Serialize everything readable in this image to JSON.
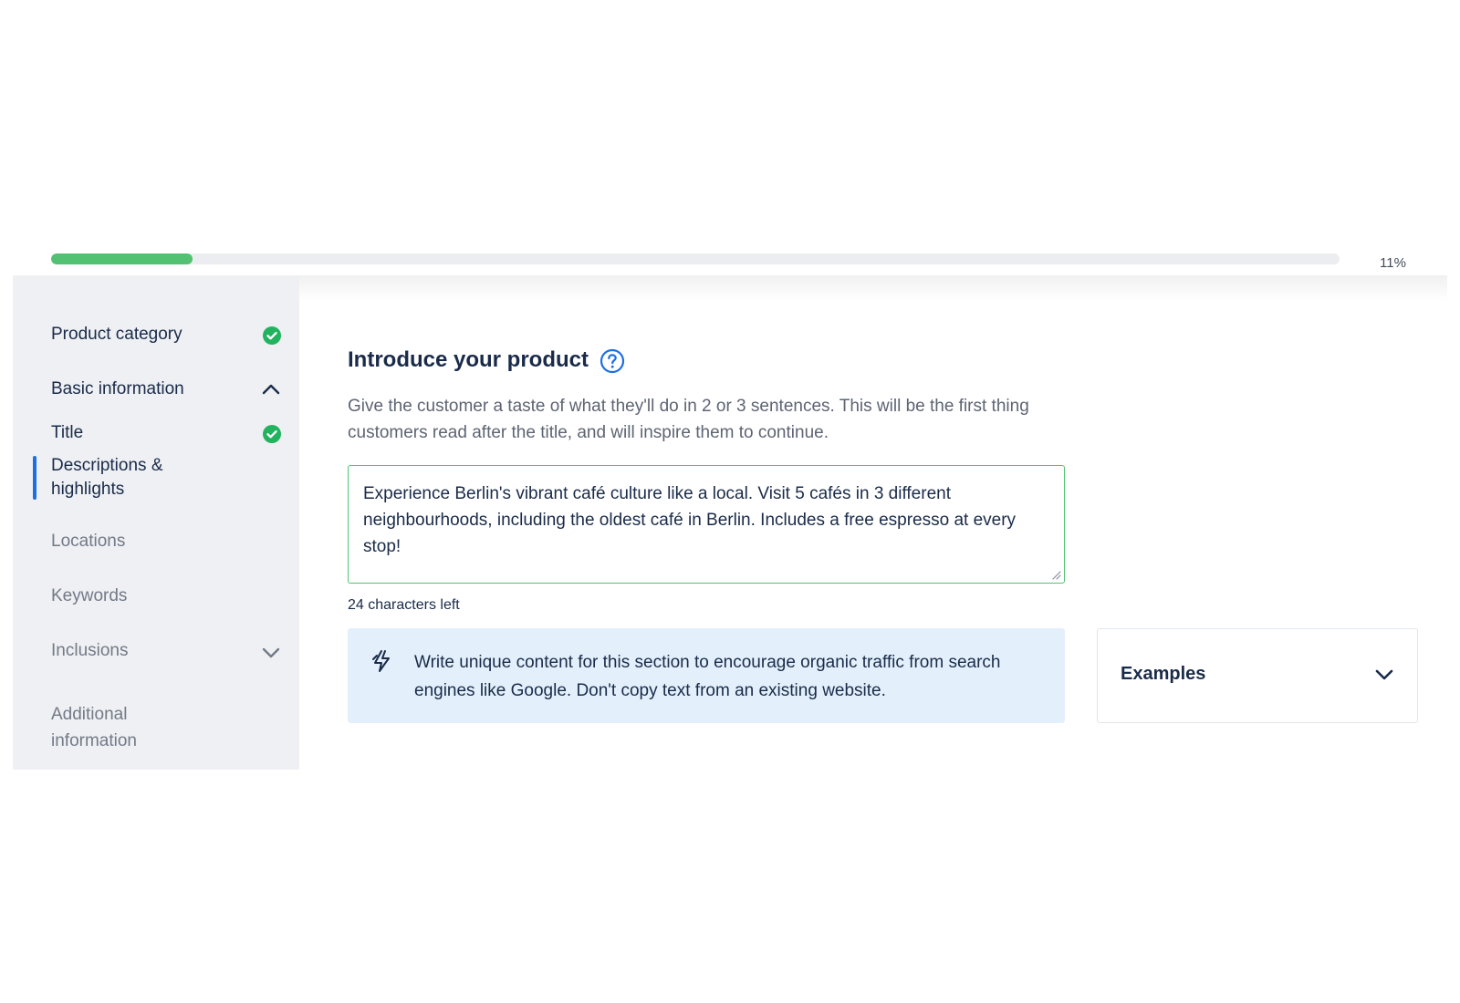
{
  "progress": {
    "percent_label": "11%",
    "fraction": 0.11
  },
  "sidebar": {
    "items": [
      {
        "label": "Product category",
        "status": "complete"
      },
      {
        "label": "Basic information",
        "expanded": true
      },
      {
        "label": "Title",
        "status": "complete"
      },
      {
        "label": "Descriptions & highlights",
        "active": true
      },
      {
        "label": "Locations"
      },
      {
        "label": "Keywords"
      },
      {
        "label": "Inclusions",
        "expanded": false
      },
      {
        "label": "Additional information"
      }
    ]
  },
  "main": {
    "title": "Introduce your product",
    "description": "Give the customer a taste of what they'll do in 2 or 3 sentences. This will be the first thing customers read after the title, and will inspire them to continue.",
    "textarea_value": "Experience Berlin's vibrant café culture like a local. Visit 5 cafés in 3 different neighbourhoods, including the oldest café in Berlin. Includes a free espresso at every stop!",
    "char_count": "24 characters left",
    "tip": "Write unique content for this section to encourage organic traffic from search engines like Google. Don't copy text from an existing website.",
    "examples_label": "Examples"
  },
  "colors": {
    "progress_fill": "#53c172",
    "accent_blue": "#1e6fe0",
    "check_green": "#22b35e",
    "tip_background": "#e3f0fc"
  },
  "icons": [
    "check-circle-icon",
    "chevron-up-icon",
    "chevron-down-icon",
    "help-circle-icon",
    "bolt-icon"
  ]
}
